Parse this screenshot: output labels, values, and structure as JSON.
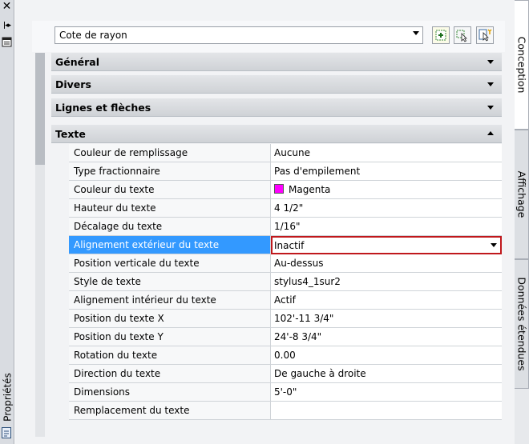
{
  "palette_title": "Propriétés",
  "left_icons": [
    "close-icon",
    "auto-hide-icon",
    "properties-menu-icon",
    "properties-palette-icon"
  ],
  "object_selector": {
    "value": "Cote de rayon"
  },
  "toolbar_icons": [
    "toggle-pickadd-icon",
    "select-objects-icon",
    "quick-select-icon"
  ],
  "categories": {
    "general": "Général",
    "misc": "Divers",
    "lines_arrows": "Lignes et flèches",
    "text": "Texte"
  },
  "properties": [
    {
      "name": "Couleur de remplissage",
      "value": "Aucune"
    },
    {
      "name": "Type fractionnaire",
      "value": "Pas d'empilement"
    },
    {
      "name": "Couleur du texte",
      "value": "Magenta",
      "swatch": "#ff00ff"
    },
    {
      "name": "Hauteur du texte",
      "value": "4 1/2\""
    },
    {
      "name": "Décalage du texte",
      "value": "1/16\""
    },
    {
      "name": "Alignement extérieur du texte",
      "value": "Inactif",
      "selected": true
    },
    {
      "name": "Position verticale du texte",
      "value": "Au-dessus"
    },
    {
      "name": "Style de texte",
      "value": "stylus4_1sur2"
    },
    {
      "name": "Alignement intérieur du texte",
      "value": "Actif"
    },
    {
      "name": "Position du texte X",
      "value": "102'-11 3/4\""
    },
    {
      "name": "Position du texte Y",
      "value": "24'-8 3/4\""
    },
    {
      "name": "Rotation du texte",
      "value": "0.00"
    },
    {
      "name": "Direction du texte",
      "value": "De gauche à droite"
    },
    {
      "name": "Dimensions",
      "value": "5'-0\""
    },
    {
      "name": "Remplacement du texte",
      "value": ""
    }
  ],
  "tabs": [
    "Conception",
    "Affichage",
    "Données étendues"
  ],
  "colors": {
    "selection": "#3399ff",
    "focus_border": "#c0181c",
    "magenta": "#ff00ff"
  }
}
